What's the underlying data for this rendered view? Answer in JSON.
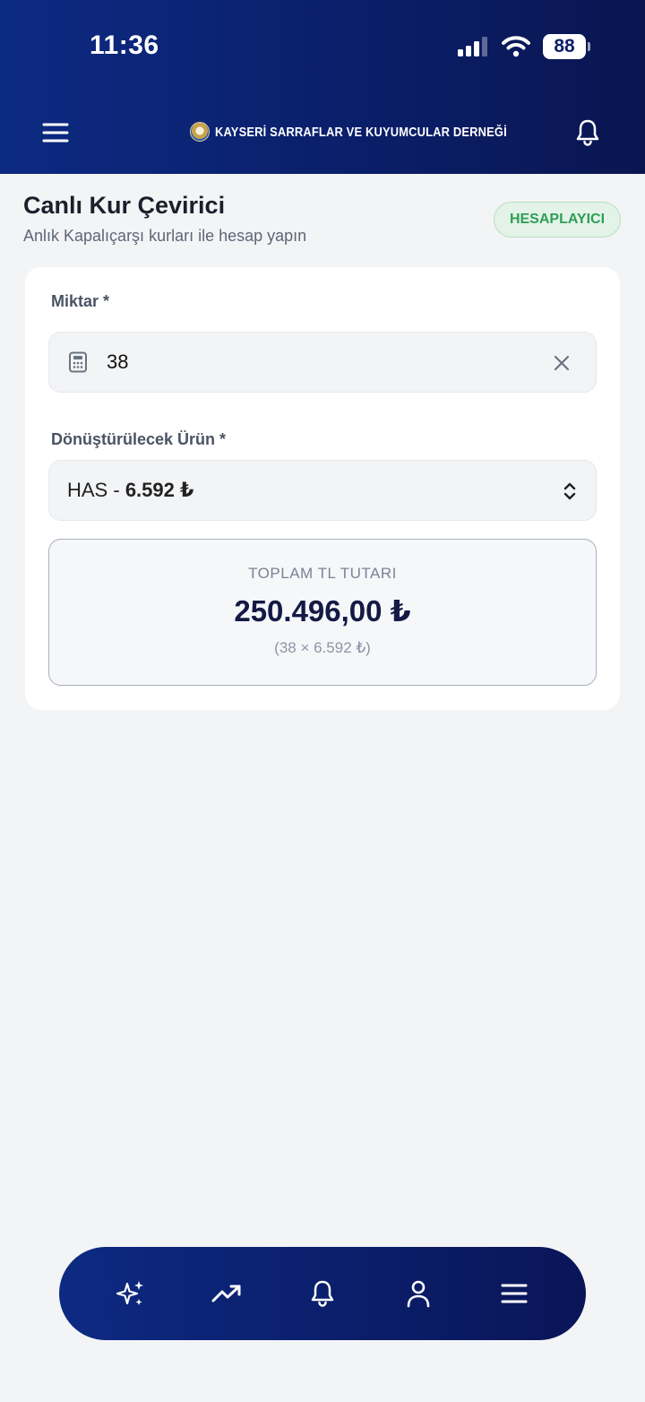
{
  "status_bar": {
    "time": "11:36",
    "battery": "88"
  },
  "header": {
    "brand_name": "KAYSERİ SARRAFLAR VE KUYUMCULAR DERNEĞİ",
    "icons": {
      "menu": "hamburger-icon",
      "notifications": "bell-icon"
    },
    "background_color": "#0a1f6a"
  },
  "page": {
    "title": "Canlı Kur Çevirici",
    "subtitle": "Anlık Kapalıçarşı kurları ile hesap yapın",
    "badge": "HESAPLAYICI",
    "badge_color": "#2f9e57"
  },
  "form": {
    "amount_label": "Miktar *",
    "amount_value": "38",
    "product_label": "Dönüştürülecek Ürün *",
    "product_name": "HAS",
    "product_separator": " - ",
    "product_price": "6.592 ₺"
  },
  "result": {
    "title": "TOPLAM TL TUTARI",
    "value": "250.496,00 ₺",
    "formula": "(38 × 6.592 ₺)"
  },
  "bottom_nav": {
    "items": [
      {
        "icon": "sparkles-icon"
      },
      {
        "icon": "trending-up-icon"
      },
      {
        "icon": "bell-icon"
      },
      {
        "icon": "user-icon"
      },
      {
        "icon": "menu-icon"
      }
    ]
  }
}
